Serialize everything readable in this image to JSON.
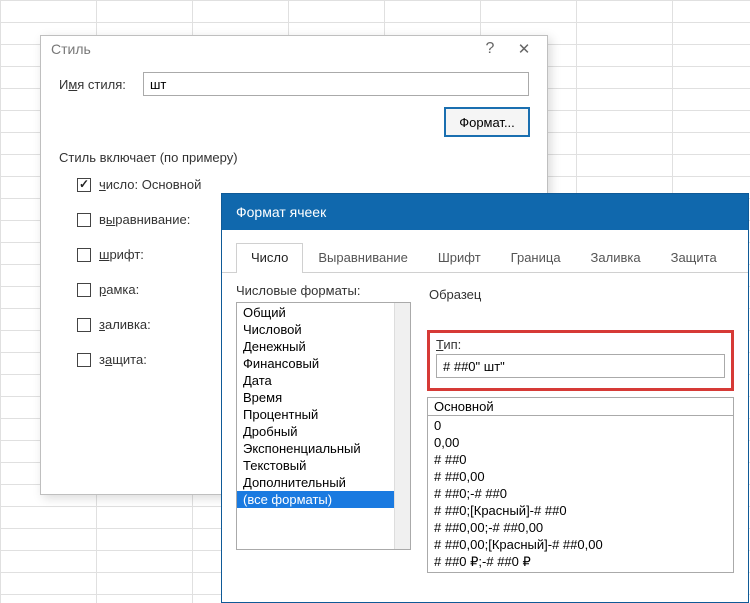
{
  "style_dialog": {
    "title": "Стиль",
    "name_label_pre": "И",
    "name_label_u": "м",
    "name_label_post": "я стиля:",
    "name_value": "шт",
    "format_button": "Формат...",
    "includes_label": "Стиль включает (по примеру)",
    "checks": [
      {
        "pre": "",
        "u": "ч",
        "post": "исло: Основной",
        "checked": true
      },
      {
        "pre": "в",
        "u": "ы",
        "post": "равнивание:",
        "checked": false
      },
      {
        "pre": "",
        "u": "ш",
        "post": "рифт:",
        "checked": false
      },
      {
        "pre": "",
        "u": "р",
        "post": "амка:",
        "checked": false
      },
      {
        "pre": "",
        "u": "з",
        "post": "аливка:",
        "checked": false
      },
      {
        "pre": "з",
        "u": "а",
        "post": "щита:",
        "checked": false
      }
    ]
  },
  "format_dialog": {
    "title": "Формат ячеек",
    "tabs": [
      "Число",
      "Выравнивание",
      "Шрифт",
      "Граница",
      "Заливка",
      "Защита"
    ],
    "active_tab": 0,
    "formats_label": "Числовые форматы:",
    "formats": [
      "Общий",
      "Числовой",
      "Денежный",
      "Финансовый",
      "Дата",
      "Время",
      "Процентный",
      "Дробный",
      "Экспоненциальный",
      "Текстовый",
      "Дополнительный",
      "(все форматы)"
    ],
    "selected_format_index": 11,
    "sample_label": "Образец",
    "type_label_u": "Т",
    "type_label_post": "ип:",
    "type_value": "# ##0\" шт\"",
    "codes_top": "Основной",
    "codes": [
      "0",
      "0,00",
      "# ##0",
      "# ##0,00",
      "# ##0;-# ##0",
      "# ##0;[Красный]-# ##0",
      "# ##0,00;-# ##0,00",
      "# ##0,00;[Красный]-# ##0,00",
      "# ##0 ₽;-# ##0 ₽"
    ]
  }
}
